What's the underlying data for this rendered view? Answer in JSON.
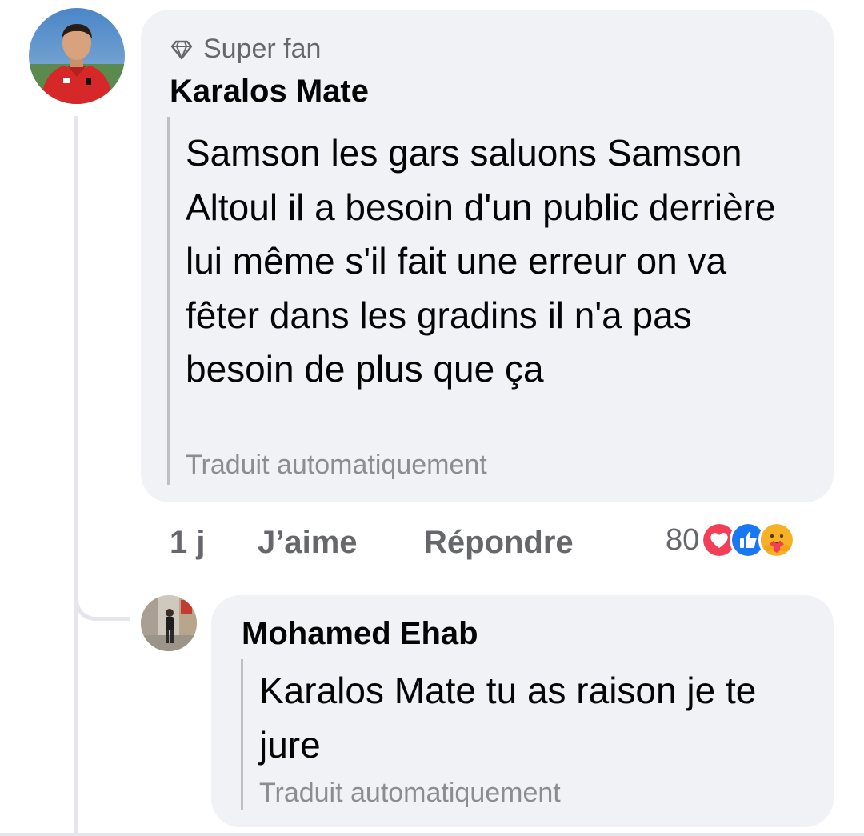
{
  "main_comment": {
    "badge_label": "Super fan",
    "badge_icon": "diamond-icon",
    "author": "Karalos Mate",
    "text": "Samson les gars saluons Samson Altoul il a besoin d'un public derrière lui même s'il fait une erreur on va fêter dans les gradins il n'a pas besoin de plus que ça",
    "translation_label": "Traduit automatiquement",
    "time": "1 j",
    "like_label": "J’aime",
    "reply_label": "Répondre",
    "reaction_count": "80",
    "reactions": [
      "love-reaction-icon",
      "like-reaction-icon",
      "care-reaction-icon"
    ]
  },
  "reply_comment": {
    "author": "Mohamed Ehab",
    "text": "Karalos Mate tu as raison je te jure",
    "translation_label": "Traduit automatiquement"
  },
  "colors": {
    "bubble_bg": "#f0f2f5",
    "secondary_text": "#65676b",
    "love": "#f33e58",
    "like": "#1877f2",
    "care": "#f7b125"
  }
}
